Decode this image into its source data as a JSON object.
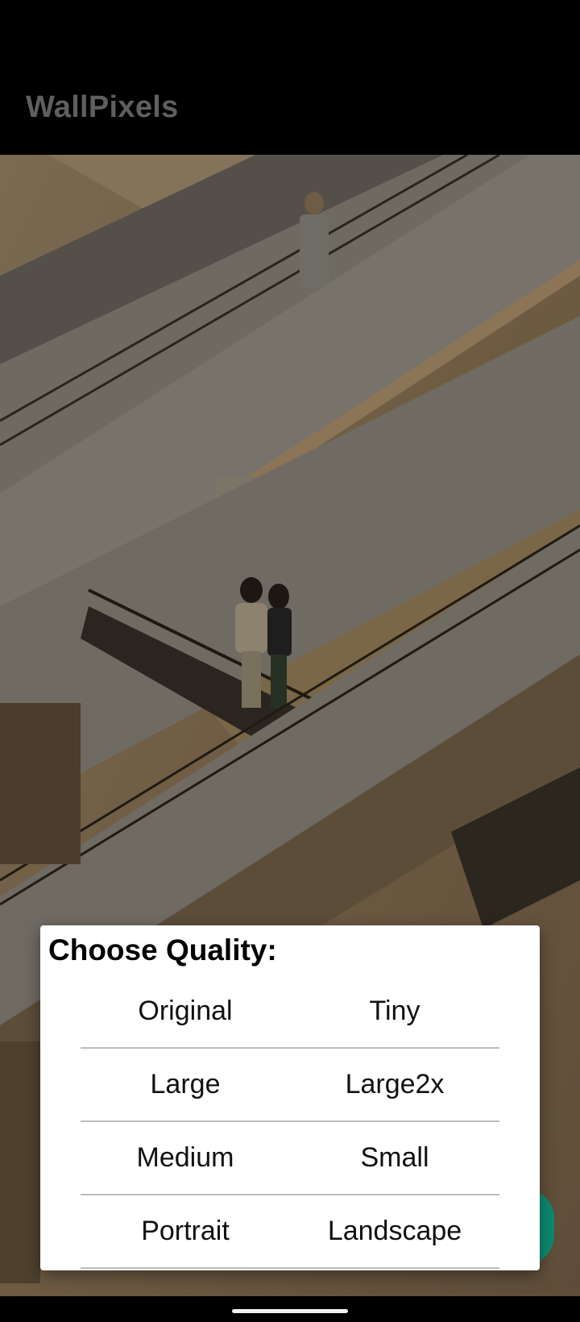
{
  "app": {
    "title": "WallPixels"
  },
  "dialog": {
    "title": "Choose Quality:",
    "rows": [
      [
        "Original",
        "Tiny"
      ],
      [
        "Large",
        "Large2x"
      ],
      [
        "Medium",
        "Small"
      ],
      [
        "Portrait",
        "Landscape"
      ]
    ]
  },
  "colors": {
    "app_bar_bg": "#000000",
    "app_title": "#5f5f5f",
    "dialog_bg": "#ffffff",
    "divider": "#bdbdbd",
    "fab": "#0d8a72"
  },
  "icons": {
    "home_indicator": "home-pill"
  }
}
